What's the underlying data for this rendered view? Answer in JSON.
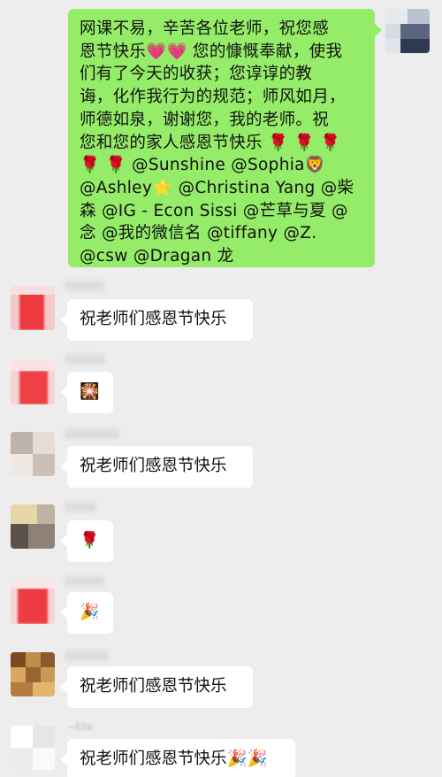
{
  "colors": {
    "background": "#ededed",
    "my_bubble": "#95ec69",
    "other_bubble": "#ffffff"
  },
  "my_message": {
    "lines": [
      "网课不易，辛苦各位老师，祝您感",
      "恩节快乐💗💗 您的慷慨奉献，使我",
      "们有了今天的收获；您谆谆的教",
      "诲，化作我行为的规范；师风如月，",
      "师德如泉，谢谢您，我的老师。祝",
      "您和您的家人感恩节快乐 🌹 🌹 🌹",
      "🌹 🌹 @Sunshine @Sophia🦁",
      "@Ashley⭐  @Christina Yang @柴",
      "森 @IG - Econ Sissi @芒草与夏 @",
      "念 @我的微信名  @tiffany @Z.",
      "@csw @Dragan 龙"
    ]
  },
  "messages": [
    {
      "text": "祝老师们感恩节快乐",
      "avatar_icon": "blurred-avatar-icon"
    },
    {
      "text": "🎇",
      "avatar_icon": "blurred-avatar-icon"
    },
    {
      "text": "祝老师们感恩节快乐",
      "avatar_icon": "blurred-avatar-icon"
    },
    {
      "text": "🌹",
      "avatar_icon": "blurred-avatar-icon"
    },
    {
      "text": "🎉",
      "avatar_icon": "blurred-avatar-icon"
    },
    {
      "text": "祝老师们感恩节快乐",
      "avatar_icon": "blurred-avatar-icon"
    },
    {
      "text": "祝老师们感恩节快乐🎉🎉",
      "avatar_icon": "blurred-avatar-icon"
    }
  ],
  "sender_names": [
    "~Elle"
  ]
}
